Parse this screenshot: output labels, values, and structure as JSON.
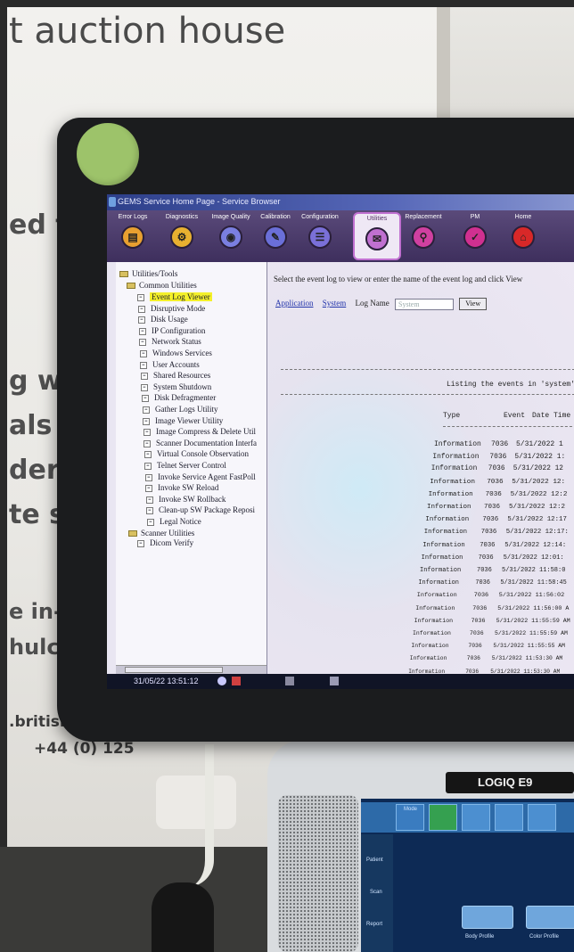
{
  "banner": {
    "title_fragment": "t auction house",
    "line1": "ed t",
    "line2": "g wi",
    "line3": "als a",
    "line4": "ders i",
    "line5": "te sec",
    "line6": "e in-hou",
    "line7": "hulcast",
    "web": ".britishme",
    "phone": "+44 (0) 125"
  },
  "window": {
    "title": "GEMS Service Home Page - Service Browser"
  },
  "toolbar": {
    "items": [
      {
        "label": "Error Logs",
        "color": "#e8a030",
        "glyph": "▤"
      },
      {
        "label": "Diagnostics",
        "color": "#e8b030",
        "glyph": "⚙"
      },
      {
        "label": "Image Quality",
        "color": "#7a7fe0",
        "glyph": "◉"
      },
      {
        "label": "Calibration",
        "color": "#6a6fd8",
        "glyph": "✎"
      },
      {
        "label": "Configuration",
        "color": "#7a70d8",
        "glyph": "☰"
      },
      {
        "label": "Utilities",
        "color": "#c070d0",
        "glyph": "✉"
      },
      {
        "label": "Replacement",
        "color": "#d040a0",
        "glyph": "⚲"
      },
      {
        "label": "PM",
        "color": "#d03090",
        "glyph": "✓"
      },
      {
        "label": "Home",
        "color": "#d82828",
        "glyph": "⌂"
      }
    ]
  },
  "tree": {
    "root": "Utilities/Tools",
    "group": "Common Utilities",
    "items": [
      "Event Log Viewer",
      "Disruptive Mode",
      "Disk Usage",
      "IP Configuration",
      "Network Status",
      "Windows Services",
      "User Accounts",
      "Shared Resources",
      "System Shutdown",
      "Disk Defragmenter",
      "Gather Logs Utility",
      "Image Viewer Utility",
      "Image Compress & Delete Util",
      "Scanner Documentation Interfa",
      "Virtual Console Observation",
      "Telnet Server Control",
      "Invoke Service Agent FastPoll",
      "Invoke SW Reload",
      "Invoke SW Rollback",
      "Clean-up SW Package Reposi",
      "Legal Notice"
    ],
    "group2": "Scanner Utilities",
    "group2_item": "Dicom Verify"
  },
  "pane": {
    "instruction": "Select the event log to view or enter the name of the event log and click View",
    "link_application": "Application",
    "link_system": "System",
    "log_name_label": "Log Name",
    "log_name_value": "System",
    "view_button": "View",
    "listing": "Listing the events in 'system'",
    "col_type": "Type",
    "col_event": "Event",
    "col_datetime": "Date Time",
    "rows": [
      {
        "type": "Information",
        "event": "7036",
        "date": "5/31/2022 1"
      },
      {
        "type": "Information",
        "event": "7036",
        "date": "5/31/2022 1:"
      },
      {
        "type": "Information",
        "event": "7036",
        "date": "5/31/2022 12"
      },
      {
        "type": "Information",
        "event": "7036",
        "date": "5/31/2022 12:"
      },
      {
        "type": "Information",
        "event": "7036",
        "date": "5/31/2022 12:2"
      },
      {
        "type": "Information",
        "event": "7036",
        "date": "5/31/2022 12:2"
      },
      {
        "type": "Information",
        "event": "7036",
        "date": "5/31/2022 12:17"
      },
      {
        "type": "Information",
        "event": "7036",
        "date": "5/31/2022 12:17:"
      },
      {
        "type": "Information",
        "event": "7036",
        "date": "5/31/2022 12:14:"
      },
      {
        "type": "Information",
        "event": "7036",
        "date": "5/31/2022 12:01:"
      },
      {
        "type": "Information",
        "event": "7036",
        "date": "5/31/2022 11:58:0"
      },
      {
        "type": "Information",
        "event": "7036",
        "date": "5/31/2022 11:58:45"
      },
      {
        "type": "Information",
        "event": "7036",
        "date": "5/31/2022 11:56:02"
      },
      {
        "type": "Information",
        "event": "7036",
        "date": "5/31/2022 11:56:00 A"
      },
      {
        "type": "Information",
        "event": "7036",
        "date": "5/31/2022 11:55:59 AM"
      },
      {
        "type": "Information",
        "event": "7036",
        "date": "5/31/2022 11:55:59 AM"
      },
      {
        "type": "Information",
        "event": "7036",
        "date": "5/31/2022 11:55:55 AM"
      },
      {
        "type": "Information",
        "event": "7036",
        "date": "5/31/2022 11:53:30 AM"
      },
      {
        "type": "Information",
        "event": "7036",
        "date": "5/31/2022 11:53:30 AM"
      }
    ]
  },
  "taskbar": {
    "clock": "31/05/22 13:51:12"
  },
  "console": {
    "model": "LOGIQ E9",
    "tab_mode": "Mode",
    "side_patient": "Patient",
    "side_scan": "Scan",
    "side_report": "Report",
    "caption_left": "Body Profile",
    "caption_right": "Color Profile"
  }
}
